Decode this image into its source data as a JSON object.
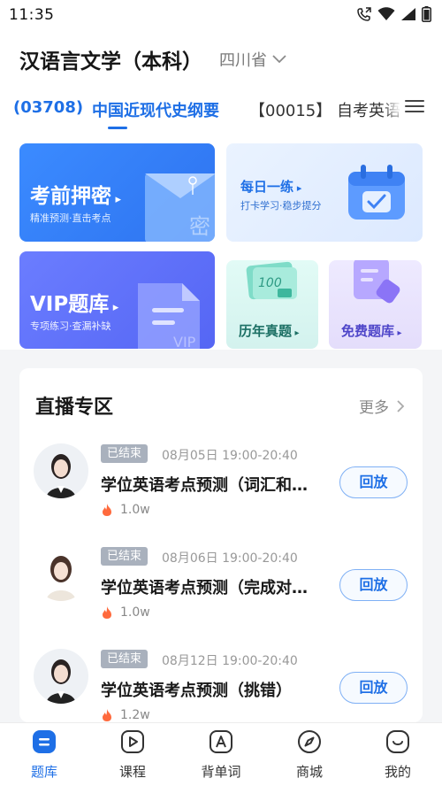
{
  "status_bar": {
    "time": "11:35"
  },
  "header": {
    "course_title": "汉语言文学（本科）",
    "province": "四川省"
  },
  "tabs": [
    {
      "label": "(03708)",
      "active": true
    },
    {
      "label": "中国近现代史纲要",
      "active": true
    },
    {
      "label": "【00015】 自考英语",
      "active": false
    }
  ],
  "cards": {
    "exam": {
      "title": "考前押密",
      "subtitle": "精准预测·直击考点",
      "watermark": "密"
    },
    "daily": {
      "title": "每日一练",
      "subtitle": "打卡学习·稳步提分"
    },
    "vip": {
      "title": "VIP题库",
      "subtitle": "专项练习·查漏补缺",
      "watermark": "VIP"
    },
    "past": {
      "title": "历年真题",
      "icon_text": "100"
    },
    "free": {
      "title": "免费题库"
    }
  },
  "live": {
    "title": "直播专区",
    "more": "更多",
    "items": [
      {
        "status": "已结束",
        "time": "08月05日 19:00-20:40",
        "title": "学位英语考点预测（词汇和…",
        "views": "1.0w",
        "button": "回放"
      },
      {
        "status": "已结束",
        "time": "08月06日 19:00-20:40",
        "title": "学位英语考点预测（完成对…",
        "views": "1.0w",
        "button": "回放"
      },
      {
        "status": "已结束",
        "time": "08月12日 19:00-20:40",
        "title": "学位英语考点预测（挑错）",
        "views": "1.2w",
        "button": "回放"
      }
    ]
  },
  "bottom_nav": [
    {
      "label": "题库",
      "icon": "question-bank-icon",
      "active": true
    },
    {
      "label": "课程",
      "icon": "play-icon",
      "active": false
    },
    {
      "label": "背单词",
      "icon": "letter-a-icon",
      "active": false
    },
    {
      "label": "商城",
      "icon": "compass-icon",
      "active": false
    },
    {
      "label": "我的",
      "icon": "smile-icon",
      "active": false
    }
  ],
  "colors": {
    "accent": "#1e6fe6",
    "badge": "#a9b1bd",
    "fire": "#ff6a3d"
  }
}
